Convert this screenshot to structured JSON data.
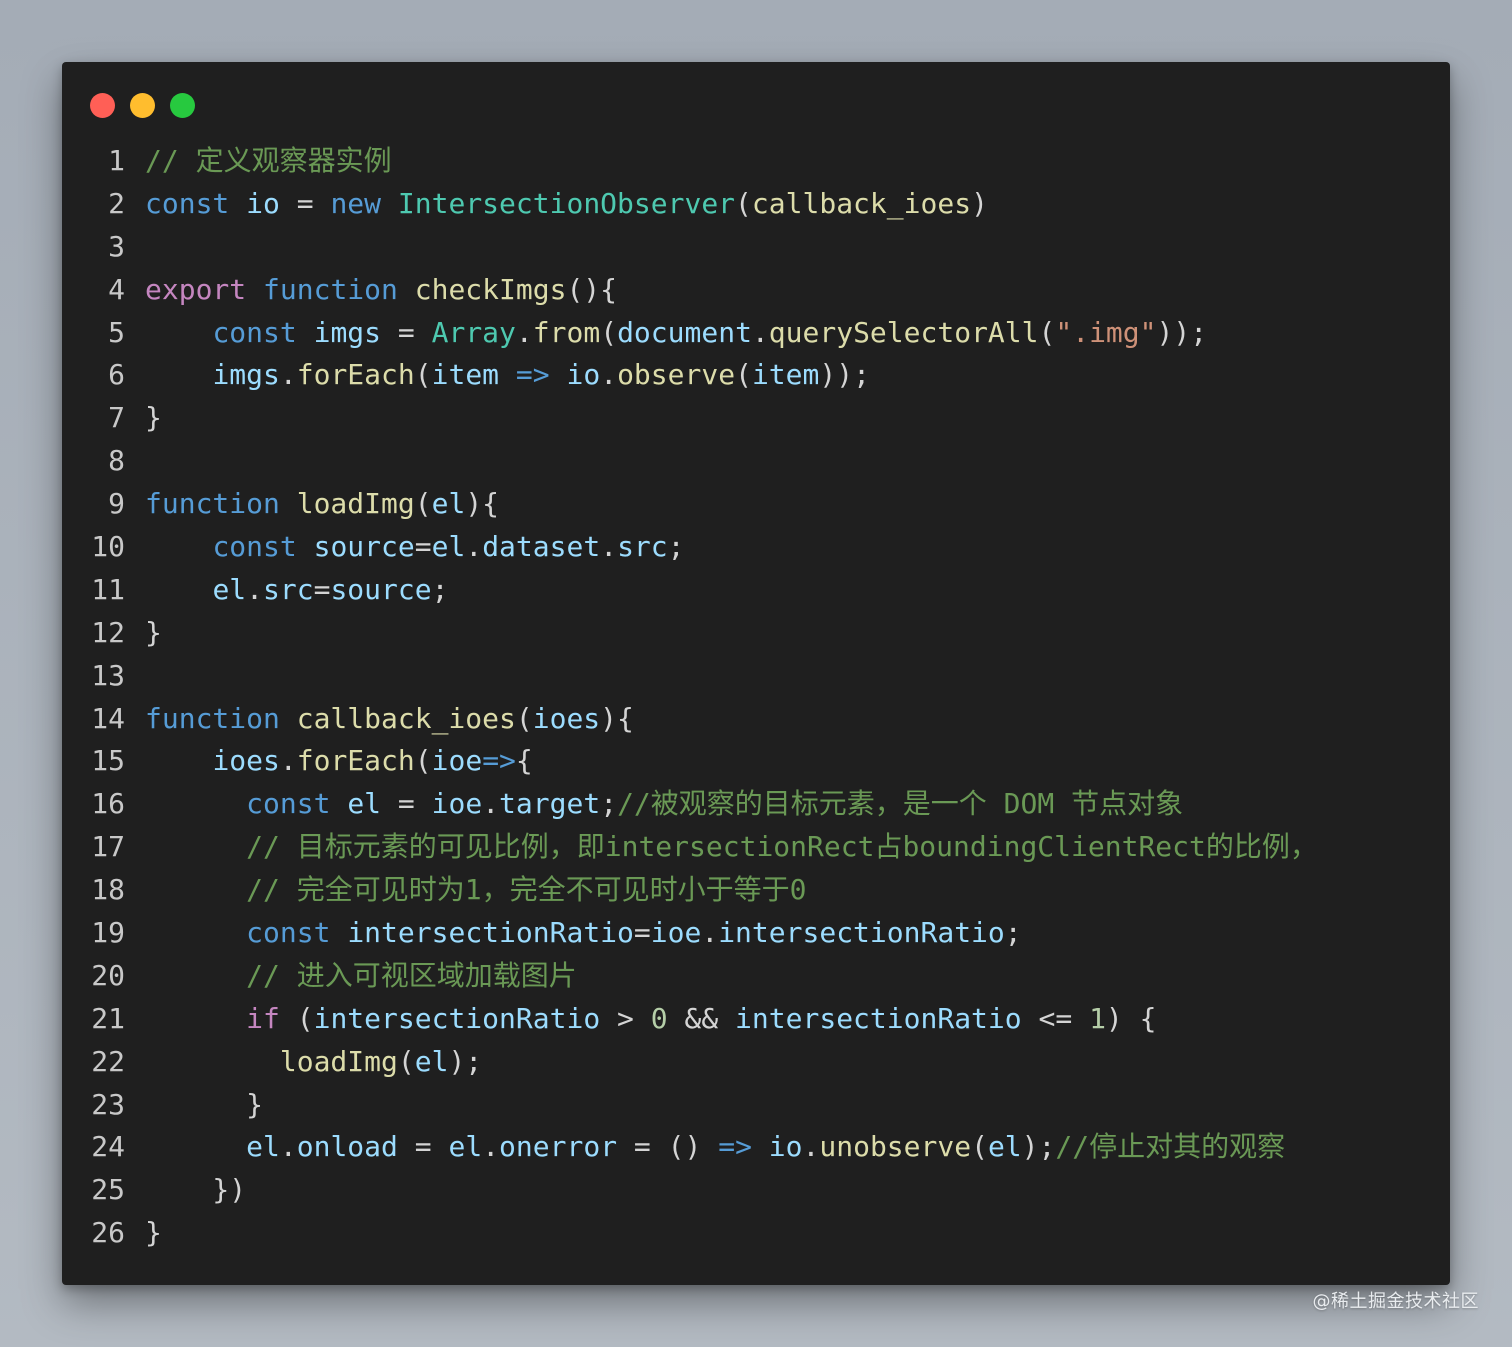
{
  "colors": {
    "keyword": "#569cd6",
    "control": "#c586c0",
    "function": "#dcdcaa",
    "type": "#4ec9b0",
    "variable": "#9cdcfe",
    "string": "#ce9178",
    "number": "#b5cea8",
    "comment": "#6a9955",
    "plain": "#d4d4d4",
    "line_number": "#c8c8c8"
  },
  "window_controls": [
    {
      "name": "close-dot",
      "color": "#ff5f56"
    },
    {
      "name": "minimize-dot",
      "color": "#ffbd2e"
    },
    {
      "name": "maximize-dot",
      "color": "#27c93f"
    }
  ],
  "code": {
    "lines": [
      {
        "no": "1",
        "tokens": [
          [
            "comment",
            "// 定义观察器实例"
          ]
        ]
      },
      {
        "no": "2",
        "tokens": [
          [
            "keyword",
            "const"
          ],
          [
            "plain",
            " "
          ],
          [
            "variable",
            "io"
          ],
          [
            "plain",
            " = "
          ],
          [
            "keyword",
            "new"
          ],
          [
            "plain",
            " "
          ],
          [
            "type",
            "IntersectionObserver"
          ],
          [
            "plain",
            "("
          ],
          [
            "function",
            "callback_ioes"
          ],
          [
            "plain",
            ")"
          ]
        ]
      },
      {
        "no": "3",
        "tokens": []
      },
      {
        "no": "4",
        "tokens": [
          [
            "control",
            "export"
          ],
          [
            "plain",
            " "
          ],
          [
            "keyword",
            "function"
          ],
          [
            "plain",
            " "
          ],
          [
            "function",
            "checkImgs"
          ],
          [
            "plain",
            "(){"
          ]
        ]
      },
      {
        "no": "5",
        "tokens": [
          [
            "plain",
            "    "
          ],
          [
            "keyword",
            "const"
          ],
          [
            "plain",
            " "
          ],
          [
            "variable",
            "imgs"
          ],
          [
            "plain",
            " = "
          ],
          [
            "type",
            "Array"
          ],
          [
            "plain",
            "."
          ],
          [
            "function",
            "from"
          ],
          [
            "plain",
            "("
          ],
          [
            "variable",
            "document"
          ],
          [
            "plain",
            "."
          ],
          [
            "function",
            "querySelectorAll"
          ],
          [
            "plain",
            "("
          ],
          [
            "string",
            "\".img\""
          ],
          [
            "plain",
            "));"
          ]
        ]
      },
      {
        "no": "6",
        "tokens": [
          [
            "plain",
            "    "
          ],
          [
            "variable",
            "imgs"
          ],
          [
            "plain",
            "."
          ],
          [
            "function",
            "forEach"
          ],
          [
            "plain",
            "("
          ],
          [
            "variable",
            "item"
          ],
          [
            "plain",
            " "
          ],
          [
            "keyword",
            "=>"
          ],
          [
            "plain",
            " "
          ],
          [
            "variable",
            "io"
          ],
          [
            "plain",
            "."
          ],
          [
            "function",
            "observe"
          ],
          [
            "plain",
            "("
          ],
          [
            "variable",
            "item"
          ],
          [
            "plain",
            "));"
          ]
        ]
      },
      {
        "no": "7",
        "tokens": [
          [
            "plain",
            "}"
          ]
        ]
      },
      {
        "no": "8",
        "tokens": []
      },
      {
        "no": "9",
        "tokens": [
          [
            "keyword",
            "function"
          ],
          [
            "plain",
            " "
          ],
          [
            "function",
            "loadImg"
          ],
          [
            "plain",
            "("
          ],
          [
            "variable",
            "el"
          ],
          [
            "plain",
            "){"
          ]
        ]
      },
      {
        "no": "10",
        "tokens": [
          [
            "plain",
            "    "
          ],
          [
            "keyword",
            "const"
          ],
          [
            "plain",
            " "
          ],
          [
            "variable",
            "source"
          ],
          [
            "plain",
            "="
          ],
          [
            "variable",
            "el"
          ],
          [
            "plain",
            "."
          ],
          [
            "variable",
            "dataset"
          ],
          [
            "plain",
            "."
          ],
          [
            "variable",
            "src"
          ],
          [
            "plain",
            ";"
          ]
        ]
      },
      {
        "no": "11",
        "tokens": [
          [
            "plain",
            "    "
          ],
          [
            "variable",
            "el"
          ],
          [
            "plain",
            "."
          ],
          [
            "variable",
            "src"
          ],
          [
            "plain",
            "="
          ],
          [
            "variable",
            "source"
          ],
          [
            "plain",
            ";"
          ]
        ]
      },
      {
        "no": "12",
        "tokens": [
          [
            "plain",
            "}"
          ]
        ]
      },
      {
        "no": "13",
        "tokens": []
      },
      {
        "no": "14",
        "tokens": [
          [
            "keyword",
            "function"
          ],
          [
            "plain",
            " "
          ],
          [
            "function",
            "callback_ioes"
          ],
          [
            "plain",
            "("
          ],
          [
            "variable",
            "ioes"
          ],
          [
            "plain",
            "){"
          ]
        ]
      },
      {
        "no": "15",
        "tokens": [
          [
            "plain",
            "    "
          ],
          [
            "variable",
            "ioes"
          ],
          [
            "plain",
            "."
          ],
          [
            "function",
            "forEach"
          ],
          [
            "plain",
            "("
          ],
          [
            "variable",
            "ioe"
          ],
          [
            "keyword",
            "=>"
          ],
          [
            "plain",
            "{"
          ]
        ]
      },
      {
        "no": "16",
        "tokens": [
          [
            "plain",
            "      "
          ],
          [
            "keyword",
            "const"
          ],
          [
            "plain",
            " "
          ],
          [
            "variable",
            "el"
          ],
          [
            "plain",
            " = "
          ],
          [
            "variable",
            "ioe"
          ],
          [
            "plain",
            "."
          ],
          [
            "variable",
            "target"
          ],
          [
            "plain",
            ";"
          ],
          [
            "comment",
            "//被观察的目标元素，是一个 DOM 节点对象"
          ]
        ]
      },
      {
        "no": "17",
        "tokens": [
          [
            "plain",
            "      "
          ],
          [
            "comment",
            "// 目标元素的可见比例，即intersectionRect占boundingClientRect的比例，"
          ]
        ]
      },
      {
        "no": "18",
        "tokens": [
          [
            "plain",
            "      "
          ],
          [
            "comment",
            "// 完全可见时为1，完全不可见时小于等于0"
          ]
        ]
      },
      {
        "no": "19",
        "tokens": [
          [
            "plain",
            "      "
          ],
          [
            "keyword",
            "const"
          ],
          [
            "plain",
            " "
          ],
          [
            "variable",
            "intersectionRatio"
          ],
          [
            "plain",
            "="
          ],
          [
            "variable",
            "ioe"
          ],
          [
            "plain",
            "."
          ],
          [
            "variable",
            "intersectionRatio"
          ],
          [
            "plain",
            ";"
          ]
        ]
      },
      {
        "no": "20",
        "tokens": [
          [
            "plain",
            "      "
          ],
          [
            "comment",
            "// 进入可视区域加载图片"
          ]
        ]
      },
      {
        "no": "21",
        "tokens": [
          [
            "plain",
            "      "
          ],
          [
            "control",
            "if"
          ],
          [
            "plain",
            " ("
          ],
          [
            "variable",
            "intersectionRatio"
          ],
          [
            "plain",
            " > "
          ],
          [
            "number",
            "0"
          ],
          [
            "plain",
            " && "
          ],
          [
            "variable",
            "intersectionRatio"
          ],
          [
            "plain",
            " <= "
          ],
          [
            "number",
            "1"
          ],
          [
            "plain",
            ") {"
          ]
        ]
      },
      {
        "no": "22",
        "tokens": [
          [
            "plain",
            "        "
          ],
          [
            "function",
            "loadImg"
          ],
          [
            "plain",
            "("
          ],
          [
            "variable",
            "el"
          ],
          [
            "plain",
            ");"
          ]
        ]
      },
      {
        "no": "23",
        "tokens": [
          [
            "plain",
            "      }"
          ]
        ]
      },
      {
        "no": "24",
        "tokens": [
          [
            "plain",
            "      "
          ],
          [
            "variable",
            "el"
          ],
          [
            "plain",
            "."
          ],
          [
            "variable",
            "onload"
          ],
          [
            "plain",
            " = "
          ],
          [
            "variable",
            "el"
          ],
          [
            "plain",
            "."
          ],
          [
            "variable",
            "onerror"
          ],
          [
            "plain",
            " = () "
          ],
          [
            "keyword",
            "=>"
          ],
          [
            "plain",
            " "
          ],
          [
            "variable",
            "io"
          ],
          [
            "plain",
            "."
          ],
          [
            "function",
            "unobserve"
          ],
          [
            "plain",
            "("
          ],
          [
            "variable",
            "el"
          ],
          [
            "plain",
            ");"
          ],
          [
            "comment",
            "//停止对其的观察"
          ]
        ]
      },
      {
        "no": "25",
        "tokens": [
          [
            "plain",
            "    })"
          ]
        ]
      },
      {
        "no": "26",
        "tokens": [
          [
            "plain",
            "}"
          ]
        ]
      }
    ]
  },
  "watermark": "@稀土掘金技术社区"
}
